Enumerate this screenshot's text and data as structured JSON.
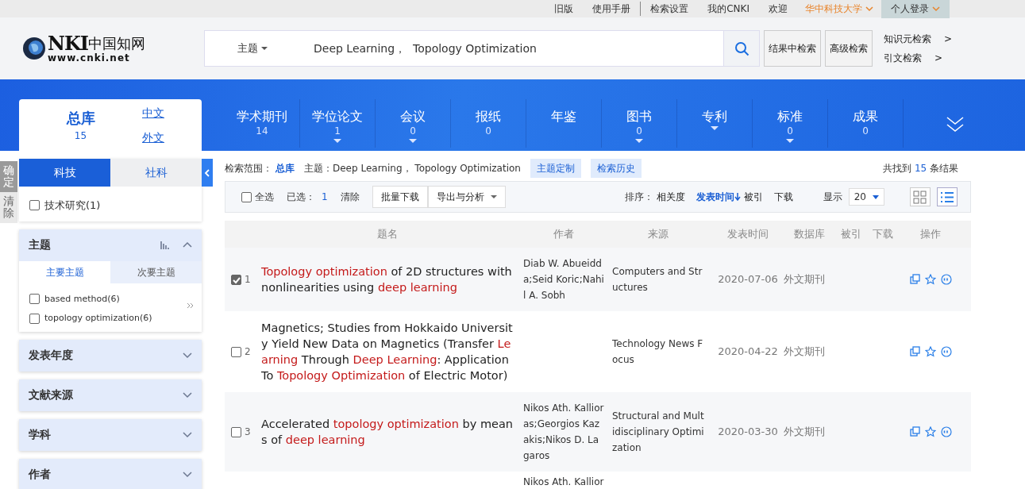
{
  "top_links": [
    "旧版",
    "使用手册",
    "检索设置",
    "我的CNKI",
    "欢迎"
  ],
  "institution": "华中科技大学",
  "login": "个人登录",
  "logo": {
    "mark": "NKI",
    "cn": "中国知网",
    "url": "www.cnki.net"
  },
  "search": {
    "field": "主题",
    "query": "Deep Learning，  Topology Optimization"
  },
  "search_buttons": [
    "结果中检索",
    "高级检索"
  ],
  "side_links": [
    {
      "label": "知识元检索",
      "arrow": ">"
    },
    {
      "label": "引文检索",
      "arrow": ">"
    }
  ],
  "library": {
    "title": "总库",
    "count": "15",
    "links": [
      "中文",
      "外文"
    ]
  },
  "databases": [
    {
      "label": "学术期刊",
      "count": "14",
      "dropdown": false
    },
    {
      "label": "学位论文",
      "count": "1",
      "dropdown": true
    },
    {
      "label": "会议",
      "count": "0",
      "dropdown": true
    },
    {
      "label": "报纸",
      "count": "0",
      "dropdown": false
    },
    {
      "label": "年鉴",
      "dropdown": false
    },
    {
      "label": "图书",
      "count": "0",
      "dropdown": true
    },
    {
      "label": "专利",
      "dropdown": true
    },
    {
      "label": "标准",
      "count": "0",
      "dropdown": true
    },
    {
      "label": "成果",
      "count": "0",
      "dropdown": false
    }
  ],
  "filter_actions": [
    "确定",
    "清除"
  ],
  "discipline_tabs": [
    {
      "label": "科技",
      "selected": true
    },
    {
      "label": "社科",
      "selected": false
    }
  ],
  "discipline_items": [
    {
      "label": "技术研究(1)",
      "checked": false
    }
  ],
  "facets": [
    {
      "title": "主题",
      "expanded": true,
      "tabs": [
        {
          "label": "主要主题",
          "selected": true
        },
        {
          "label": "次要主题",
          "selected": false
        }
      ],
      "items": [
        {
          "label": "based method(6)",
          "checked": false
        },
        {
          "label": "topology optimization(6)",
          "checked": false
        }
      ]
    },
    {
      "title": "发表年度",
      "expanded": false
    },
    {
      "title": "文献来源",
      "expanded": false
    },
    {
      "title": "学科",
      "expanded": false
    },
    {
      "title": "作者",
      "expanded": false
    }
  ],
  "scope": {
    "label": "检索范围：",
    "library": "总库",
    "topic": "主题：Deep Learning，  Topology Optimization"
  },
  "scope_buttons": [
    "主题定制",
    "检索历史"
  ],
  "result_count": {
    "prefix": "共找到",
    "count": "15",
    "suffix": "条结果"
  },
  "toolbar": {
    "select_all": {
      "label": "全选",
      "checked": false
    },
    "selected_label": "已选：",
    "selected_count": "1",
    "clear": "清除",
    "buttons": [
      "批量下载",
      "导出与分析"
    ]
  },
  "sort": {
    "label": "排序：",
    "options": [
      {
        "label": "相关度",
        "selected": false
      },
      {
        "label": "发表时间",
        "selected": true
      },
      {
        "label": "被引",
        "selected": false
      },
      {
        "label": "下载",
        "selected": false
      }
    ]
  },
  "display": {
    "label": "显示",
    "value": "20"
  },
  "views": [
    {
      "kind": "grid",
      "selected": false
    },
    {
      "kind": "list",
      "selected": true
    }
  ],
  "table": {
    "columns": [
      "题名",
      "作者",
      "来源",
      "发表时间",
      "数据库",
      "被引",
      "下载",
      "操作"
    ],
    "rows": [
      {
        "selected": true,
        "number": "1",
        "title": [
          {
            "text": "Topology optimization",
            "highlight": true
          },
          {
            "text": " of 2D structures with nonlinearities using ",
            "highlight": false
          },
          {
            "text": "deep learning",
            "highlight": true
          }
        ],
        "authors": "Diab W. Abueidda;Seid Koric;Nahil A. Sobh",
        "source": "Computers and Structures",
        "date": "2020-07-06",
        "database": "外文期刊"
      },
      {
        "selected": false,
        "number": "2",
        "title": [
          {
            "text": "Magnetics; Studies from Hokkaido University Yield New Data on Magnetics (Transfer ",
            "highlight": false
          },
          {
            "text": "Learning",
            "highlight": true
          },
          {
            "text": " Through ",
            "highlight": false
          },
          {
            "text": "Deep Learning",
            "highlight": true
          },
          {
            "text": ": Application To ",
            "highlight": false
          },
          {
            "text": "Topology Optimization",
            "highlight": true
          },
          {
            "text": " of Electric Motor)",
            "highlight": false
          }
        ],
        "source": "Technology News Focus",
        "date": "2020-04-22",
        "database": "外文期刊"
      },
      {
        "selected": false,
        "number": "3",
        "title": [
          {
            "text": "Accelerated ",
            "highlight": false
          },
          {
            "text": "topology optimization",
            "highlight": true
          },
          {
            "text": " by means of ",
            "highlight": false
          },
          {
            "text": "deep learning",
            "highlight": true
          }
        ],
        "authors": "Nikos Ath. Kallioras;Georgios Kazakis;Nikos D. Lagaros",
        "source": "Structural and Multidisciplinary Optimization",
        "date": "2020-03-30",
        "database": "外文期刊"
      },
      {
        "authors": "Nikos Ath. Kallior"
      }
    ]
  }
}
